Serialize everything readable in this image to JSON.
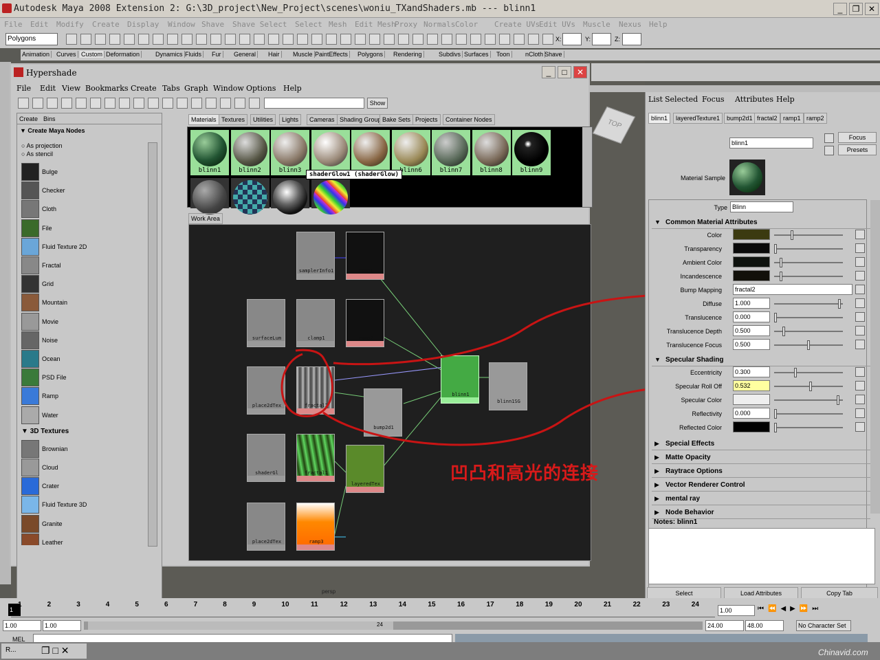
{
  "window": {
    "title": "Autodesk Maya 2008 Extension 2: G:\\3D_project\\New_Project\\scenes\\woniu_TXandShaders.mb    ---    blinn1"
  },
  "main_menu": [
    "File",
    "Edit",
    "Modify",
    "Create",
    "Display",
    "Window",
    "Shave",
    "Shave Select",
    "Select",
    "Mesh",
    "Edit Mesh",
    "Proxy",
    "Normals",
    "Color",
    "Create UVs",
    "Edit UVs",
    "Muscle",
    "Nexus",
    "Help"
  ],
  "toolbar": {
    "mode": "Polygons",
    "x_label": "X:",
    "y_label": "Y:",
    "z_label": "Z:"
  },
  "shelf_tabs": [
    "Animation",
    "Curves",
    "Custom",
    "Deformation",
    "Dynamics",
    "Fluids",
    "Fur",
    "General",
    "Hair",
    "Muscle",
    "PaintEffects",
    "Polygons",
    "Rendering",
    "Subdivs",
    "Surfaces",
    "Toon",
    "nCloth",
    "Shave"
  ],
  "hypershade": {
    "title": "Hypershade",
    "menu": [
      "File",
      "Edit",
      "View",
      "Bookmarks",
      "Create",
      "Tabs",
      "Graph",
      "Window",
      "Options",
      "Help"
    ],
    "show_button": "Show",
    "left_tabs": [
      "Create",
      "Bins"
    ],
    "create_header": "Create Maya Nodes",
    "radios": [
      "As projection",
      "As stencil"
    ],
    "nodes_2d": [
      "Bulge",
      "Checker",
      "Cloth",
      "File",
      "Fluid Texture 2D",
      "Fractal",
      "Grid",
      "Mountain",
      "Movie",
      "Noise",
      "Ocean",
      "PSD File",
      "Ramp",
      "Water"
    ],
    "section_3d": "3D Textures",
    "nodes_3d": [
      "Brownian",
      "Cloud",
      "Crater",
      "Fluid Texture 3D",
      "Granite",
      "Leather"
    ],
    "scroll_left": "<<",
    "scroll_right": ">>",
    "bin_tabs": [
      "Materials",
      "Textures",
      "Utilities",
      "Lights",
      "Cameras",
      "Shading Groups",
      "Bake Sets",
      "Projects",
      "Container Nodes"
    ],
    "materials": [
      "blinn1",
      "blinn2",
      "blinn3",
      "",
      "",
      "blinn6",
      "blinn7",
      "blinn8",
      "blinn9"
    ],
    "tooltip": "shaderGlow1 (shaderGlow)",
    "work_area_tab": "Work Area",
    "graph_nodes": [
      "samplerInfo1",
      "ramp1",
      "surfaceLum",
      "clamp1",
      "ramp2",
      "place2dTex",
      "fractal2",
      "bump2d1",
      "blinn1",
      "blinn1SG",
      "shaderGl",
      "fractal1",
      "layeredTex",
      "place2dTex",
      "ramp3"
    ]
  },
  "annotation": "凹凸和高光的连接",
  "viewport": {
    "camera": "persp",
    "cube_label": "TOP"
  },
  "attribute_editor": {
    "menu": [
      "List",
      "Selected",
      "Focus",
      "Attributes",
      "Help"
    ],
    "tabs": [
      "blinn1",
      "layeredTexture1",
      "bump2d1",
      "fractal2",
      "ramp1",
      "ramp2"
    ],
    "node_label": "blinn:",
    "node_name": "blinn1",
    "focus_button": "Focus",
    "presets_button": "Presets",
    "material_sample_label": "Material Sample",
    "type_label": "Type",
    "type_value": "Blinn",
    "common_header": "Common Material Attributes",
    "common": [
      {
        "label": "Color",
        "value": "",
        "color": "#3b3a10",
        "knob": 0.25
      },
      {
        "label": "Transparency",
        "value": "",
        "color": "#0a0a0a",
        "knob": 0.0
      },
      {
        "label": "Ambient Color",
        "value": "",
        "color": "#0e120e",
        "knob": 0.08
      },
      {
        "label": "Incandescence",
        "value": "",
        "color": "#12100a",
        "knob": 0.08
      },
      {
        "label": "Bump Mapping",
        "value": "fractal2"
      },
      {
        "label": "Diffuse",
        "value": "1.000",
        "knob": 0.97
      },
      {
        "label": "Translucence",
        "value": "0.000",
        "knob": 0.0
      },
      {
        "label": "Translucence Depth",
        "value": "0.500",
        "knob": 0.12
      },
      {
        "label": "Translucence Focus",
        "value": "0.500",
        "knob": 0.5
      }
    ],
    "specular_header": "Specular Shading",
    "specular": [
      {
        "label": "Eccentricity",
        "value": "0.300",
        "knob": 0.3
      },
      {
        "label": "Specular Roll Off",
        "value": "0.532",
        "knob": 0.53
      },
      {
        "label": "Specular Color",
        "value": "",
        "color": "#eeeeee",
        "knob": 0.95
      },
      {
        "label": "Reflectivity",
        "value": "0.000",
        "knob": 0.0
      },
      {
        "label": "Reflected Color",
        "value": "",
        "color": "#000000",
        "knob": 0.0
      }
    ],
    "collapsed": [
      "Special Effects",
      "Matte Opacity",
      "Raytrace Options",
      "Vector Renderer Control",
      "mental ray",
      "Node Behavior"
    ],
    "notes_label": "Notes:  blinn1",
    "bottom_buttons": [
      "Select",
      "Load Attributes",
      "Copy Tab"
    ]
  },
  "timeline": {
    "ticks": [
      "1",
      "2",
      "3",
      "4",
      "5",
      "6",
      "7",
      "8",
      "9",
      "10",
      "11",
      "12",
      "13",
      "14",
      "15",
      "16",
      "17",
      "18",
      "19",
      "20",
      "21",
      "22",
      "23",
      "24"
    ],
    "current_frame": "1.00",
    "range_start": "1.00",
    "range_start2": "1.00",
    "range_mid": "24",
    "range_end": "24.00",
    "range_end2": "48.00",
    "character_set": "No Character Set"
  },
  "cmd": {
    "label": "MEL"
  },
  "watermark": "Chinavid.com"
}
